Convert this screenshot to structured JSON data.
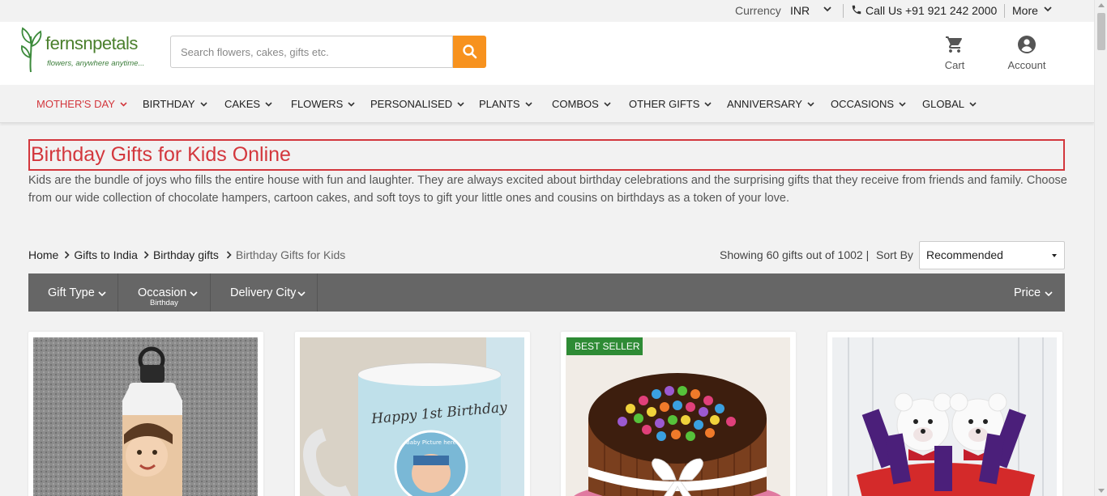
{
  "topbar": {
    "currency_label": "Currency",
    "currency_value": "INR",
    "call_label": "Call Us +91 921 242 2000",
    "more_label": "More"
  },
  "header": {
    "logo_brand": "fernsnpetals",
    "logo_tagline": "flowers, anywhere anytime...",
    "search_placeholder": "Search flowers, cakes, gifts etc.",
    "cart_label": "Cart",
    "account_label": "Account"
  },
  "nav": {
    "items": [
      {
        "label": "MOTHER'S DAY"
      },
      {
        "label": "BIRTHDAY"
      },
      {
        "label": "CAKES"
      },
      {
        "label": "FLOWERS"
      },
      {
        "label": "PERSONALISED"
      },
      {
        "label": "PLANTS"
      },
      {
        "label": "COMBOS"
      },
      {
        "label": "OTHER GIFTS"
      },
      {
        "label": "ANNIVERSARY"
      },
      {
        "label": "OCCASIONS"
      },
      {
        "label": "GLOBAL"
      }
    ]
  },
  "page": {
    "title": "Birthday Gifts for Kids Online",
    "description": "Kids are the bundle of joys who fills the entire house with fun and laughter. They are always excited about birthday celebrations and the surprising gifts that they receive from friends and family. Choose from our wide collection of chocolate hampers, cartoon cakes, and soft toys to gift your little ones and cousins on birthdays as a token of your love."
  },
  "breadcrumb": {
    "items": [
      "Home",
      "Gifts to India",
      "Birthday gifts",
      "Birthday Gifts for Kids"
    ]
  },
  "listing": {
    "showing": "Showing 60 gifts out of 1002 |",
    "sort_label": "Sort By",
    "sort_value": "Recommended"
  },
  "filters": {
    "gift_type": "Gift Type",
    "occasion": "Occasion",
    "occasion_selected": "Birthday",
    "delivery_city": "Delivery City",
    "price": "Price"
  },
  "products": {
    "badge": "BEST SELLER",
    "mug_text": "Happy 1st Birthday",
    "mug_small": "Baby Picture here"
  },
  "colors": {
    "accent_red": "#d3373d",
    "search_orange": "#f7921e",
    "filter_bg": "#666666",
    "badge_green": "#2e8b35",
    "logo_green": "#4a7f2c"
  }
}
